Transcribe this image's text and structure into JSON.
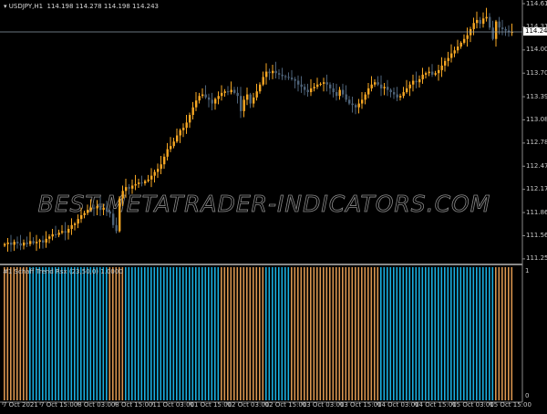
{
  "header": {
    "symbol": "USDJPY,H1",
    "ohlc": "114.198 114.278 114.198 114.243",
    "current_price": "114.243"
  },
  "indicator": {
    "title": "#1 Schaff Trend Rsx (23,50,0) 1.0000",
    "scale_top": "1",
    "scale_bottom": "0"
  },
  "watermark": "BEST-METATRADER-INDICATORS.COM",
  "colors": {
    "bull": "#f5a623",
    "bear": "#4d6278",
    "hist_up": "#d9954f",
    "hist_down": "#19aee0",
    "grid_axis": "#8a8a8a"
  },
  "chart_data": {
    "type": "candlestick",
    "symbol": "USDJPY",
    "timeframe": "H1",
    "y_ticks": [
      "114.615",
      "114.310",
      "114.005",
      "113.700",
      "113.390",
      "113.085",
      "112.780",
      "112.475",
      "112.170",
      "111.865",
      "111.560",
      "111.255"
    ],
    "ylim": [
      111.255,
      114.615
    ],
    "x_ticks": [
      "7 Oct 2021",
      "7 Oct 15:00",
      "8 Oct 03:00",
      "8 Oct 15:00",
      "11 Oct 03:00",
      "11 Oct 15:00",
      "12 Oct 03:00",
      "12 Oct 15:00",
      "13 Oct 03:00",
      "13 Oct 15:00",
      "14 Oct 03:00",
      "14 Oct 15:00",
      "15 Oct 03:00",
      "15 Oct 15:00"
    ],
    "closes": [
      111.45,
      111.47,
      111.44,
      111.48,
      111.46,
      111.43,
      111.47,
      111.45,
      111.49,
      111.46,
      111.48,
      111.5,
      111.47,
      111.52,
      111.55,
      111.58,
      111.57,
      111.6,
      111.62,
      111.6,
      111.65,
      111.7,
      111.72,
      111.78,
      111.83,
      111.86,
      111.9,
      111.93,
      111.92,
      111.95,
      111.9,
      111.93,
      111.88,
      111.85,
      111.7,
      111.62,
      112.05,
      112.15,
      112.2,
      112.18,
      112.22,
      112.24,
      112.26,
      112.25,
      112.28,
      112.3,
      112.35,
      112.4,
      112.44,
      112.5,
      112.6,
      112.7,
      112.74,
      112.8,
      112.88,
      112.95,
      112.98,
      113.05,
      113.15,
      113.25,
      113.34,
      113.4,
      113.42,
      113.38,
      113.35,
      113.3,
      113.36,
      113.4,
      113.44,
      113.46,
      113.45,
      113.48,
      113.44,
      113.4,
      113.2,
      113.35,
      113.42,
      113.3,
      113.38,
      113.46,
      113.55,
      113.65,
      113.72,
      113.7,
      113.73,
      113.7,
      113.68,
      113.66,
      113.65,
      113.64,
      113.62,
      113.6,
      113.55,
      113.52,
      113.48,
      113.45,
      113.5,
      113.52,
      113.55,
      113.56,
      113.58,
      113.55,
      113.5,
      113.45,
      113.4,
      113.48,
      113.42,
      113.35,
      113.3,
      113.28,
      113.25,
      113.3,
      113.35,
      113.42,
      113.5,
      113.55,
      113.58,
      113.55,
      113.5,
      113.52,
      113.48,
      113.45,
      113.42,
      113.38,
      113.4,
      113.45,
      113.5,
      113.55,
      113.6,
      113.58,
      113.62,
      113.68,
      113.7,
      113.72,
      113.68,
      113.7,
      113.74,
      113.8,
      113.86,
      113.9,
      113.96,
      114.0,
      114.05,
      114.1,
      114.15,
      114.2,
      114.28,
      114.36,
      114.4,
      114.35,
      114.42,
      114.44,
      114.3,
      114.15,
      114.38,
      114.3,
      114.28,
      114.26,
      114.24,
      114.243
    ],
    "indicator_segments": [
      {
        "trend": "up",
        "bars": 8
      },
      {
        "trend": "down",
        "bars": 25
      },
      {
        "trend": "up",
        "bars": 5
      },
      {
        "trend": "down",
        "bars": 30
      },
      {
        "trend": "up",
        "bars": 14
      },
      {
        "trend": "down",
        "bars": 8
      },
      {
        "trend": "up",
        "bars": 28
      },
      {
        "trend": "down",
        "bars": 36
      },
      {
        "trend": "up",
        "bars": 6
      }
    ],
    "indicator_value": 1
  }
}
